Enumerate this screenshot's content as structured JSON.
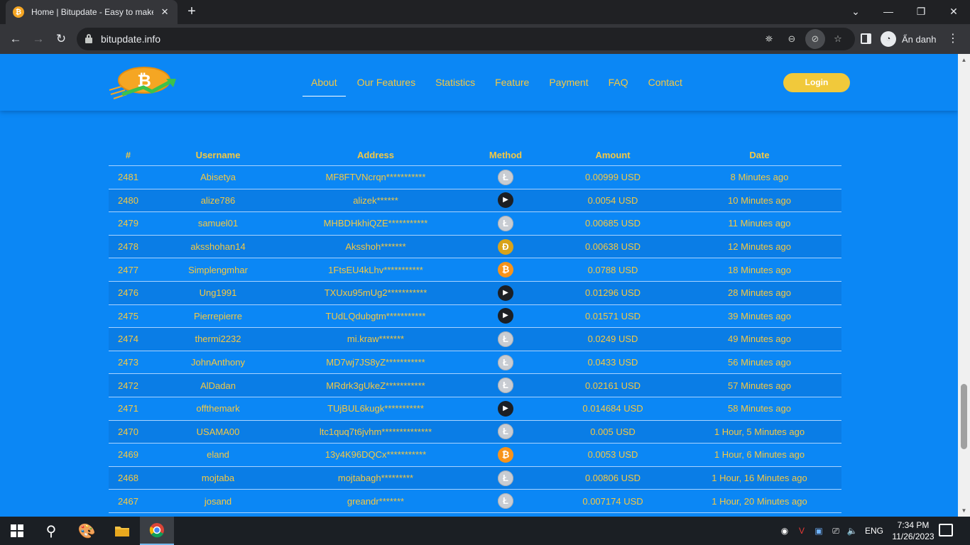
{
  "browser": {
    "tab_title": "Home | Bitupdate - Easy to make",
    "tab_favicon": "₿",
    "url": "bitupdate.info",
    "profile_label": "Ẩn danh"
  },
  "site": {
    "nav": [
      "About",
      "Our Features",
      "Statistics",
      "Feature",
      "Payment",
      "FAQ",
      "Contact"
    ],
    "login_label": "Login"
  },
  "table": {
    "headers": [
      "#",
      "Username",
      "Address",
      "Method",
      "Amount",
      "Date"
    ],
    "rows": [
      {
        "id": "2481",
        "username": "Abisetya",
        "address": "MF8FTVNcrqn***********",
        "method": "ltc",
        "amount": "0.00999 USD",
        "date": "8 Minutes ago"
      },
      {
        "id": "2480",
        "username": "alize786",
        "address": "alizek******",
        "method": "trx",
        "amount": "0.0054 USD",
        "date": "10 Minutes ago"
      },
      {
        "id": "2479",
        "username": "samuel01",
        "address": "MHBDHkhiQZE***********",
        "method": "ltc",
        "amount": "0.00685 USD",
        "date": "11 Minutes ago"
      },
      {
        "id": "2478",
        "username": "aksshohan14",
        "address": "Aksshoh*******",
        "method": "doge",
        "amount": "0.00638 USD",
        "date": "12 Minutes ago"
      },
      {
        "id": "2477",
        "username": "Simplengmhar",
        "address": "1FtsEU4kLhv***********",
        "method": "btc",
        "amount": "0.0788 USD",
        "date": "18 Minutes ago"
      },
      {
        "id": "2476",
        "username": "Ung1991",
        "address": "TXUxu95mUg2***********",
        "method": "trx",
        "amount": "0.01296 USD",
        "date": "28 Minutes ago"
      },
      {
        "id": "2475",
        "username": "Pierrepierre",
        "address": "TUdLQdubgtm***********",
        "method": "trx",
        "amount": "0.01571 USD",
        "date": "39 Minutes ago"
      },
      {
        "id": "2474",
        "username": "thermi2232",
        "address": "mi.kraw*******",
        "method": "ltc",
        "amount": "0.0249 USD",
        "date": "49 Minutes ago"
      },
      {
        "id": "2473",
        "username": "JohnAnthony",
        "address": "MD7wj7JS8yZ***********",
        "method": "ltc",
        "amount": "0.0433 USD",
        "date": "56 Minutes ago"
      },
      {
        "id": "2472",
        "username": "AlDadan",
        "address": "MRdrk3gUkeZ***********",
        "method": "ltc",
        "amount": "0.02161 USD",
        "date": "57 Minutes ago"
      },
      {
        "id": "2471",
        "username": "offthemark",
        "address": "TUjBUL6kugk***********",
        "method": "trx",
        "amount": "0.014684 USD",
        "date": "58 Minutes ago"
      },
      {
        "id": "2470",
        "username": "USAMA00",
        "address": "ltc1quq7t6jvhm**************",
        "method": "ltc",
        "amount": "0.005 USD",
        "date": "1 Hour, 5 Minutes ago"
      },
      {
        "id": "2469",
        "username": "eland",
        "address": "13y4K96DQCx***********",
        "method": "btc",
        "amount": "0.0053 USD",
        "date": "1 Hour, 6 Minutes ago"
      },
      {
        "id": "2468",
        "username": "mojtaba",
        "address": "mojtabagh*********",
        "method": "ltc",
        "amount": "0.00806 USD",
        "date": "1 Hour, 16 Minutes ago"
      },
      {
        "id": "2467",
        "username": "josand",
        "address": "greandr*******",
        "method": "ltc",
        "amount": "0.007174 USD",
        "date": "1 Hour, 20 Minutes ago"
      }
    ],
    "coin_glyphs": {
      "ltc": "Ł",
      "trx": "▶",
      "doge": "Đ",
      "btc": "₿"
    }
  },
  "taskbar": {
    "language": "ENG",
    "time": "7:34 PM",
    "date": "11/26/2023"
  },
  "colors": {
    "page_bg": "#0b87f5",
    "accent_text": "#f5c842",
    "login_button": "#f1c93b"
  }
}
